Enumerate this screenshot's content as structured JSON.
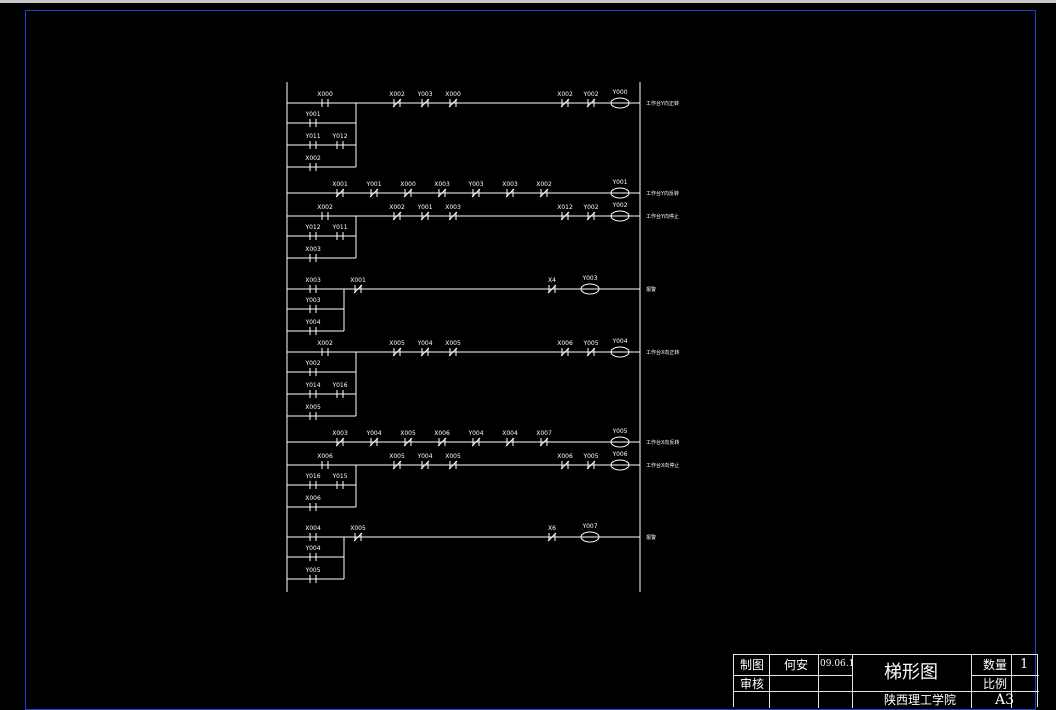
{
  "rungs": [
    {
      "top": [
        {
          "t": "NO",
          "label": "X000"
        },
        {
          "t": "NC",
          "label": "X002"
        },
        {
          "t": "NC",
          "label": "Y003"
        },
        {
          "t": "NC",
          "label": "X000"
        },
        {
          "t": "NC",
          "label": "X002"
        },
        {
          "t": "NC",
          "label": "Y002"
        }
      ],
      "coil": "Y000",
      "comment": "工作台Y向正转",
      "parallel": [
        [
          {
            "label": "Y001"
          }
        ],
        [
          {
            "label": "Y011"
          },
          {
            "label": "Y012"
          }
        ],
        [
          {
            "label": "X002"
          }
        ]
      ]
    },
    {
      "top": [
        {
          "t": "NC",
          "label": "X001"
        },
        {
          "t": "NC",
          "label": "Y001"
        },
        {
          "t": "NC",
          "label": "X000"
        },
        {
          "t": "NC",
          "label": "X003"
        },
        {
          "t": "NC",
          "label": "Y003"
        },
        {
          "t": "NC",
          "label": "X003"
        },
        {
          "t": "NC",
          "label": "X002"
        }
      ],
      "coil": "Y001",
      "comment": "工作台Y向反转",
      "parallel": []
    },
    {
      "top": [
        {
          "t": "NO",
          "label": "X002"
        },
        {
          "t": "NC",
          "label": "X002"
        },
        {
          "t": "NC",
          "label": "Y001"
        },
        {
          "t": "NC",
          "label": "X003"
        },
        {
          "t": "NC",
          "label": "X012"
        },
        {
          "t": "NC",
          "label": "Y002"
        }
      ],
      "coil": "Y002",
      "comment": "工作台Y向停止",
      "parallel": [
        [
          {
            "label": "Y012"
          },
          {
            "label": "Y011"
          }
        ],
        [
          {
            "label": "X003"
          }
        ]
      ]
    },
    {
      "top": [
        {
          "t": "NO",
          "label": "X003"
        },
        {
          "t": "NC",
          "label": "X001"
        },
        {
          "t": "NC",
          "label": "X4"
        }
      ],
      "coil": "Y003",
      "comment": "报警",
      "parallel": [
        [
          {
            "label": "Y003"
          }
        ],
        [
          {
            "label": "Y004"
          }
        ]
      ]
    },
    {
      "top": [
        {
          "t": "NO",
          "label": "X002"
        },
        {
          "t": "NC",
          "label": "X005"
        },
        {
          "t": "NC",
          "label": "Y004"
        },
        {
          "t": "NC",
          "label": "X005"
        },
        {
          "t": "NC",
          "label": "X006"
        },
        {
          "t": "NC",
          "label": "Y005"
        }
      ],
      "coil": "Y004",
      "comment": "工作台X向正转",
      "parallel": [
        [
          {
            "label": "Y002"
          }
        ],
        [
          {
            "label": "Y014"
          },
          {
            "label": "Y016"
          }
        ],
        [
          {
            "label": "X005"
          }
        ]
      ]
    },
    {
      "top": [
        {
          "t": "NC",
          "label": "X003"
        },
        {
          "t": "NC",
          "label": "Y004"
        },
        {
          "t": "NC",
          "label": "X005"
        },
        {
          "t": "NC",
          "label": "X006"
        },
        {
          "t": "NC",
          "label": "Y004"
        },
        {
          "t": "NC",
          "label": "X004"
        },
        {
          "t": "NC",
          "label": "X007"
        }
      ],
      "coil": "Y005",
      "comment": "工作台X向反转",
      "parallel": []
    },
    {
      "top": [
        {
          "t": "NO",
          "label": "X006"
        },
        {
          "t": "NC",
          "label": "X005"
        },
        {
          "t": "NC",
          "label": "Y004"
        },
        {
          "t": "NC",
          "label": "X005"
        },
        {
          "t": "NC",
          "label": "X006"
        },
        {
          "t": "NC",
          "label": "Y005"
        }
      ],
      "coil": "Y006",
      "comment": "工作台X向停止",
      "parallel": [
        [
          {
            "label": "Y016"
          },
          {
            "label": "Y015"
          }
        ],
        [
          {
            "label": "X006"
          }
        ]
      ]
    },
    {
      "top": [
        {
          "t": "NO",
          "label": "X004"
        },
        {
          "t": "NC",
          "label": "X005"
        },
        {
          "t": "NC",
          "label": "X6"
        }
      ],
      "coil": "Y007",
      "comment": "报警",
      "parallel": [
        [
          {
            "label": "Y004"
          }
        ],
        [
          {
            "label": "Y005"
          }
        ]
      ]
    }
  ],
  "titleblock": {
    "drawn_label": "制图",
    "drawer": "何安",
    "date": "09.06.1",
    "drawing_title": "梯形图",
    "qty_label": "数量",
    "qty_value": "1",
    "review_label": "审核",
    "scale_label": "比例",
    "school": "陕西理工学院",
    "sheet_size": "A3"
  },
  "colors": {
    "background": "#000000",
    "lines": "#ffffff",
    "frame": "#1f3fd0"
  }
}
